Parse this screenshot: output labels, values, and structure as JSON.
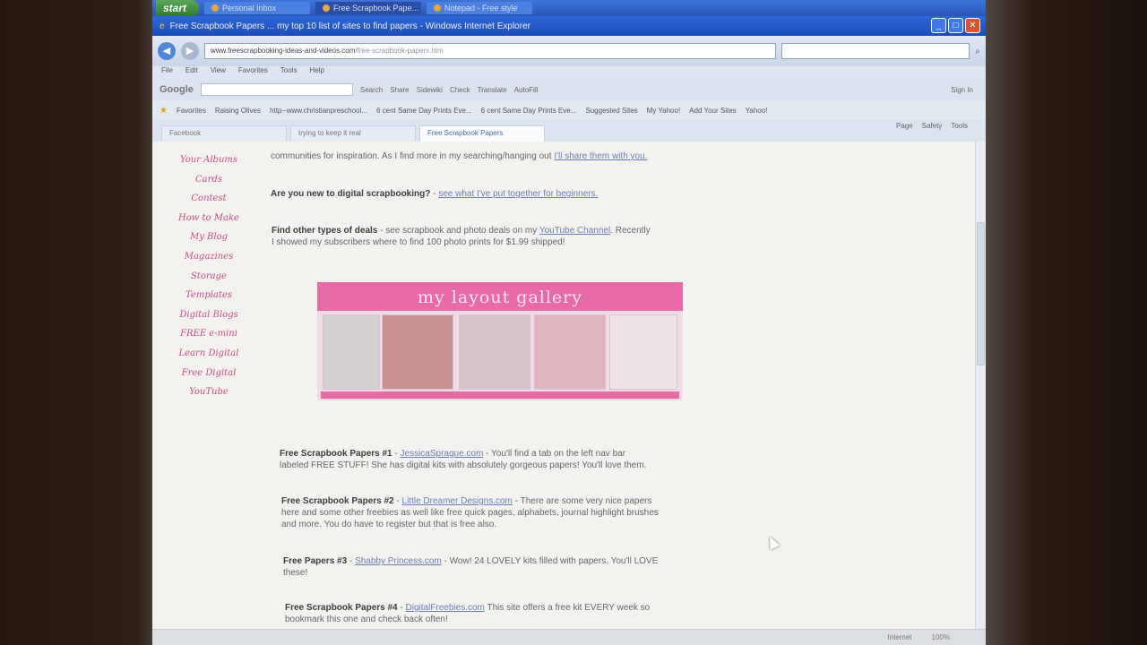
{
  "taskbar": {
    "start": "start",
    "items": [
      "Personal Inbox",
      "Free Scrapbook Pape...",
      "Notepad - Free style"
    ]
  },
  "window": {
    "title": "Free Scrapbook Papers ... my top 10 list of sites to find papers - Windows Internet Explorer"
  },
  "address": {
    "domain": "www.freescrapbooking-ideas-and-videos.com",
    "path": "/free-scrapbook-papers.htm"
  },
  "menus": [
    "File",
    "Edit",
    "View",
    "Favorites",
    "Tools",
    "Help"
  ],
  "google_bar": {
    "logo": "Google",
    "items": [
      "Search",
      "Share",
      "Sidewiki",
      "Check",
      "Translate",
      "AutoFill",
      "Sign In"
    ]
  },
  "favorites": {
    "label": "Favorites",
    "items": [
      "Raising Olives",
      "http--www.christianpreschool...",
      "6 cent Same Day Prints Eve...",
      "6 cent Same Day Prints Eve...",
      "Suggested Sites",
      "My Yahoo!",
      "Add Your Sites",
      "Yahoo!"
    ]
  },
  "tabs": [
    "Facebook",
    "trying to keep it real",
    "Free Scrapbook Papers"
  ],
  "command_bar": [
    "Page",
    "Safety",
    "Tools"
  ],
  "left_nav": [
    "Your Albums",
    "Cards",
    "Contest",
    "How to Make",
    "My Blog",
    "Magazines",
    "Storage",
    "Templates",
    "Digital Blogs",
    "FREE e-mini",
    "Learn Digital",
    "Free Digital",
    "YouTube"
  ],
  "intro": {
    "text": "communities for inspiration. As I find more in my searching/hanging out",
    "link": "I'll share them with you."
  },
  "new_digital": {
    "label": "Are you new to digital scrapbooking?",
    "sep": " - ",
    "link": "see what I've put together for beginners."
  },
  "deals": {
    "label": "Find other types of deals",
    "pre": " - see scrapbook and photo deals on my ",
    "link": "YouTube Channel",
    "post": ". Recently",
    "line2": "I showed my subscribers where to find 100 photo prints for $1.99 shipped!"
  },
  "gallery": {
    "title": "my layout gallery"
  },
  "entries": [
    {
      "label": "Free Scrapbook Papers #1",
      "link": "JessicaSprague.com",
      "text": " - You'll find a tab on the left nav bar",
      "line2": "labeled FREE STUFF! She has digital kits with absolutely gorgeous papers! You'll love them."
    },
    {
      "label": "Free Scrapbook Papers #2",
      "link": "Little Dreamer Designs.com",
      "text": " - There are some very nice papers",
      "line2": "here and some other freebies as well like free quick pages, alphabets, journal highlight brushes",
      "line3": "and more. You do have to register but that is free also."
    },
    {
      "label": "Free Papers #3",
      "link": "Shabby Princess.com",
      "text": " - Wow! 24 LOVELY kits filled with papers. You'll LOVE",
      "line2": "these!"
    },
    {
      "label": "Free Scrapbook Papers #4",
      "link": "DigitalFreebies.com",
      "text": " This site offers a free kit EVERY week so",
      "line2": "bookmark this one and check back often!"
    }
  ],
  "status": {
    "zone": "Internet",
    "zoom": "100%"
  },
  "colors": {
    "accent_pink": "#e86aa6",
    "link": "#6a7fb8",
    "ie_blue": "#2f68d8"
  }
}
